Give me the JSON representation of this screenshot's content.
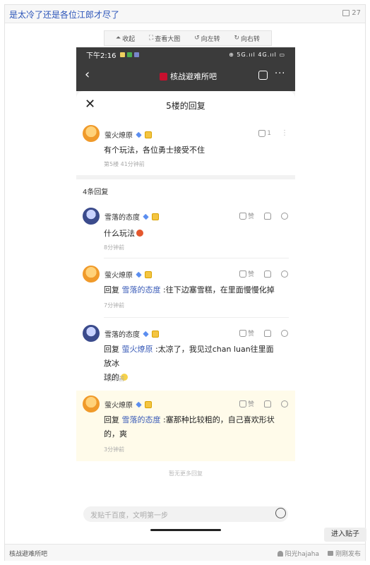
{
  "thread": {
    "title": "是太冷了还是各位江郎才尽了",
    "reply_count": "27"
  },
  "toolbar": {
    "collapse": "收起",
    "view_large": "查看大图",
    "rotate_left": "向左转",
    "rotate_right": "向右转"
  },
  "phone": {
    "status": {
      "time": "下午2:16",
      "right": "⊕ 5G.ııl 4G.ııl ▭"
    },
    "appbar": {
      "forum_name": "核战避难所吧"
    },
    "sheet_title": "5楼的回复",
    "main_post": {
      "user": "萤火燎原",
      "text": "有个玩法，各位勇士接受不住",
      "meta": "第5楼  41分钟前",
      "likes": "1"
    },
    "section_label": "4条回复",
    "replies": [
      {
        "user": "雪落的态度",
        "text": "什么玩法",
        "time": "8分钟前",
        "like_label": "赞"
      },
      {
        "user": "萤火燎原",
        "prefix": "回复",
        "mention": "雪落的态度",
        "text": " :往下边塞雪糕，在里面慢慢化掉",
        "time": "7分钟前",
        "like_label": "赞"
      },
      {
        "user": "雪落的态度",
        "prefix": "回复",
        "mention": "萤火燎原",
        "text": " :太凉了，我见过chan luan往里面放冰",
        "text2": "球的",
        "time": "5分钟前",
        "like_label": "赞"
      },
      {
        "user": "萤火燎原",
        "prefix": "回复",
        "mention": "雪落的态度",
        "text": " :塞那种比较粗的，自己喜欢形状",
        "text2": "的，爽",
        "time": "3分钟前",
        "like_label": "赞"
      }
    ],
    "no_more": "暂无更多回复",
    "input_placeholder": "发贴千百度，文明第一步"
  },
  "enter_button": "进入贴子",
  "footer": {
    "forum": "核战避难所吧",
    "author": "阳光hajaha",
    "action": "刚刚发布"
  }
}
